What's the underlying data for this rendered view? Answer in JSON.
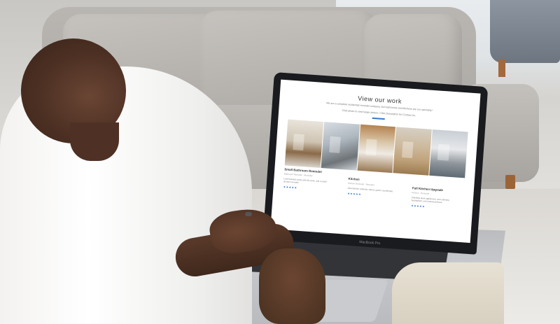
{
  "website": {
    "title": "View our work",
    "subtitle_line1": "We are a complete residential remodel company, but bathrooms and kitchens are our speciality!",
    "subtitle_line2": "Click photo to view larger picture. Click Description for Contact Us.",
    "accent_color": "#3a77c6",
    "cards": [
      {
        "title": "Small Bathroom Remodel",
        "meta": "Bathroom Remodel · Remodel",
        "text": "Level leveled vanity with tile work, and a small shower remodel.",
        "stars": "★★★★★"
      },
      {
        "title": "Kitchen",
        "meta": "Kitchen Remodel · Remodel",
        "text": "New kitchen cabinets, island, quartz countertops.",
        "stars": "★★★★★"
      },
      {
        "title": "Full Kitchen Upgrade",
        "meta": "Kitchen · Remodel",
        "text": "Stainless steel appliances, new cabinets, backsplash, and hardwood floors.",
        "stars": "★★★★★"
      }
    ]
  },
  "laptop": {
    "model_label": "MacBook Pro"
  }
}
